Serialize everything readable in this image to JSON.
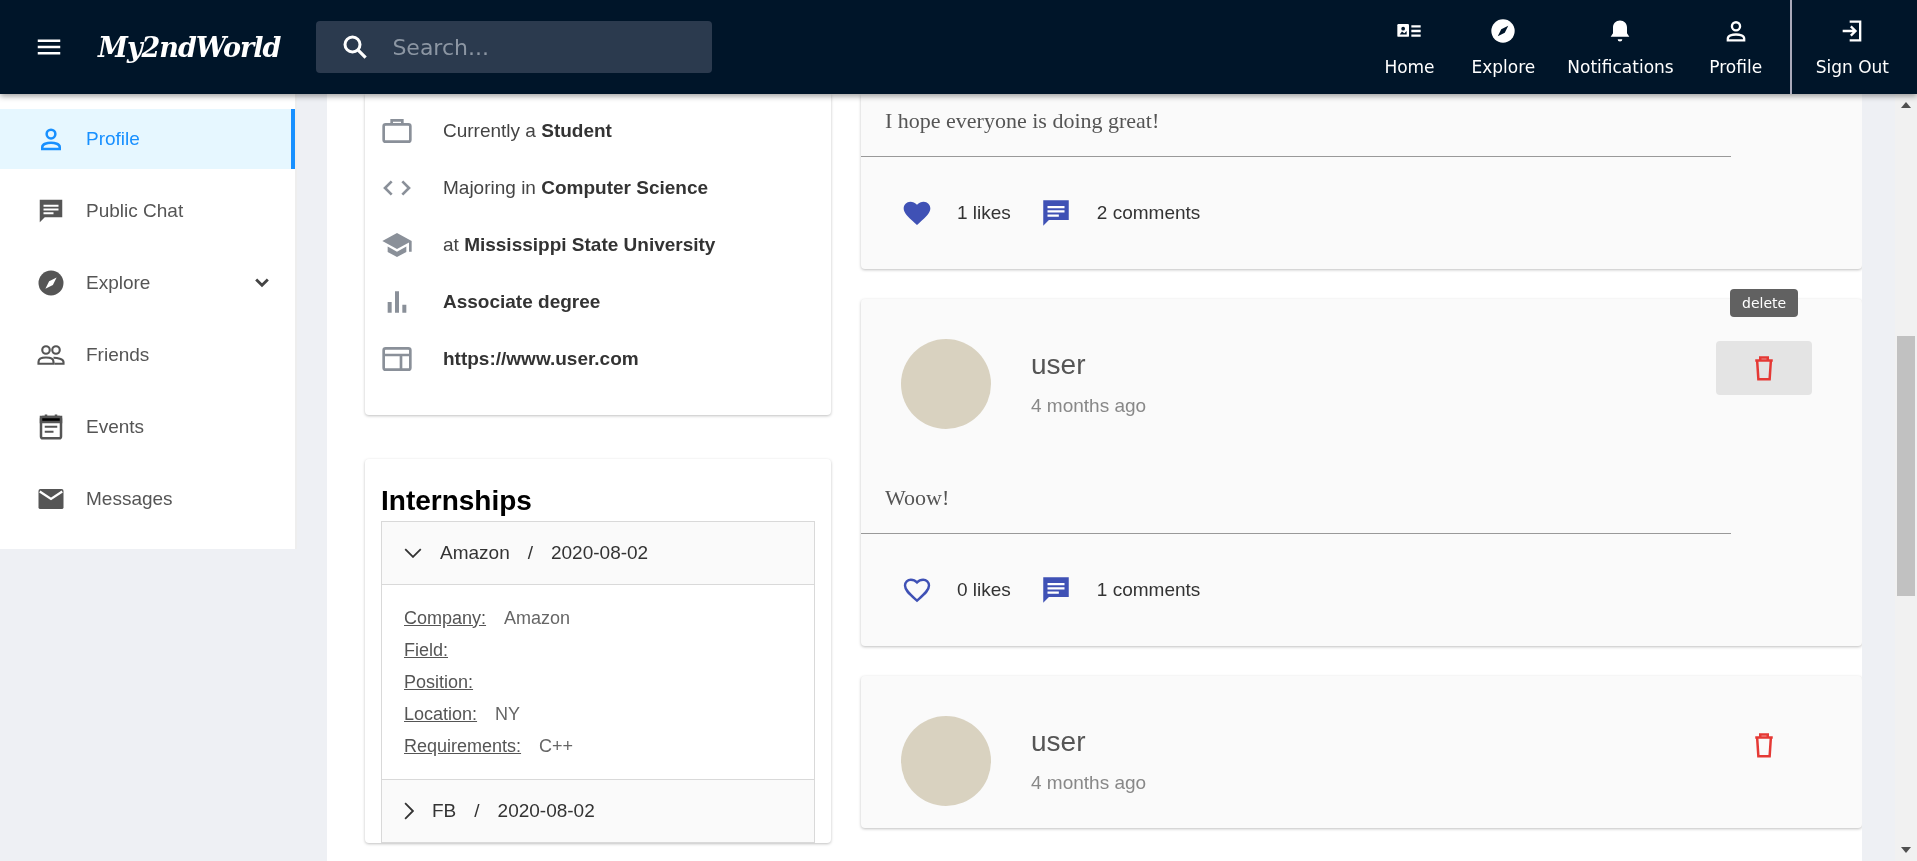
{
  "header": {
    "brand": "My2ndWorld",
    "search": {
      "placeholder": "Search..."
    },
    "nav": [
      {
        "kind": "home",
        "label": "Home"
      },
      {
        "kind": "explore",
        "label": "Explore"
      },
      {
        "kind": "notifications",
        "label": "Notifications"
      },
      {
        "kind": "profile",
        "label": "Profile"
      },
      {
        "kind": "signout",
        "label": "Sign Out"
      }
    ]
  },
  "sidebar": {
    "items": [
      {
        "kind": "profile",
        "label": "Profile",
        "selected": true
      },
      {
        "kind": "chat",
        "label": "Public Chat",
        "selected": false
      },
      {
        "kind": "explore",
        "label": "Explore",
        "selected": false,
        "expanded": false
      },
      {
        "kind": "friends",
        "label": "Friends",
        "selected": false
      },
      {
        "kind": "events",
        "label": "Events",
        "selected": false
      },
      {
        "kind": "messages",
        "label": "Messages",
        "selected": false
      }
    ]
  },
  "about": [
    {
      "kind": "briefcase",
      "prefix": "Currently a",
      "value": "Student"
    },
    {
      "kind": "code",
      "prefix": "Majoring in",
      "value": "Computer Science"
    },
    {
      "kind": "school",
      "prefix": "at",
      "value": "Mississippi State University"
    },
    {
      "kind": "chart",
      "value": "Associate degree"
    },
    {
      "kind": "web",
      "value": "https://www.user.com"
    }
  ],
  "internships": {
    "title": "Internships",
    "items": [
      {
        "company": "Amazon",
        "separator": "/",
        "date": "2020-08-02",
        "expanded": true,
        "details": [
          {
            "label": "Company:",
            "value": "Amazon"
          },
          {
            "label": "Field:"
          },
          {
            "label": "Position:"
          },
          {
            "label": "Location:",
            "value": "NY"
          },
          {
            "label": "Requirements:",
            "value": "C++"
          }
        ]
      },
      {
        "company": "FB",
        "separator": "/",
        "date": "2020-08-02",
        "expanded": false
      }
    ]
  },
  "posts": [
    {
      "text": "I hope everyone is doing great!",
      "liked": true,
      "likes": "1 likes",
      "comments": "2 comments"
    },
    {
      "author": "user",
      "time": "4 months ago",
      "hovered": true,
      "tooltip": "delete",
      "text": "Woow!",
      "liked": false,
      "likes": "0 likes",
      "comments": "1 comments"
    },
    {
      "author": "user",
      "time": "4 months ago"
    }
  ]
}
